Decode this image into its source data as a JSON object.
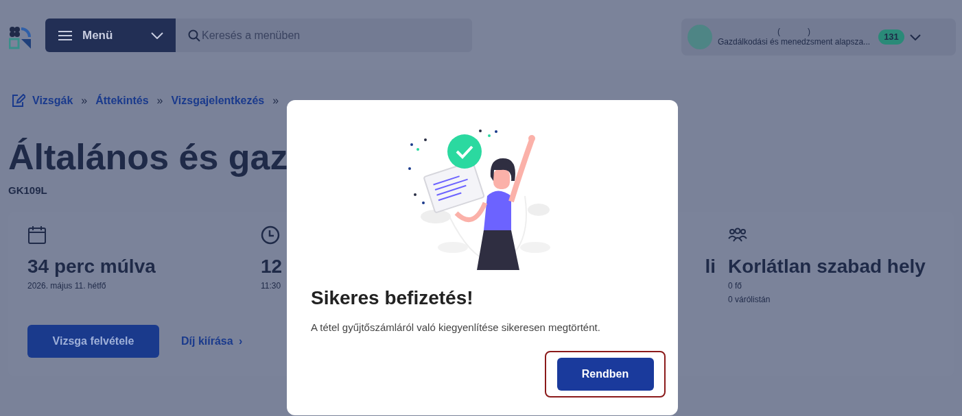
{
  "header": {
    "menu_button": "Menü",
    "search": {
      "placeholder": "Keresés a menüben"
    },
    "account": {
      "name_line": "(            )",
      "organization": "Gazdálkodási és menedzsment alapsza...",
      "badge": "131"
    }
  },
  "breadcrumb": [
    {
      "label": "Vizsgák",
      "kind": "link"
    },
    {
      "label": "»",
      "kind": "separator"
    },
    {
      "label": "Áttekintés",
      "kind": "link"
    },
    {
      "label": "»",
      "kind": "separator"
    },
    {
      "label": "Vizsgajelentkezés",
      "kind": "link"
    },
    {
      "label": "»",
      "kind": "separator"
    }
  ],
  "page": {
    "title": "Általános és gaz",
    "code": "GK109L"
  },
  "info_card": {
    "items": [
      {
        "heading": "34 perc múlva",
        "lines": [
          "2026. május 11. hétfő"
        ]
      },
      {
        "heading": "12",
        "lines": [
          "11:30"
        ]
      },
      {
        "heading": "li"
      },
      {
        "heading": "Korlátlan szabad hely",
        "lines": [
          "0 fő",
          "0 várólistán"
        ]
      }
    ],
    "primary_button": "Vizsga felvétele",
    "link": "Díj kiírása",
    "link_arrow": "›"
  },
  "modal": {
    "title": "Sikeres befizetés!",
    "message": "A tétel gyűjtőszámláról való kiegyenlítése sikeresen megtörtént.",
    "button": {
      "label": "Rendben",
      "focused": true
    }
  }
}
